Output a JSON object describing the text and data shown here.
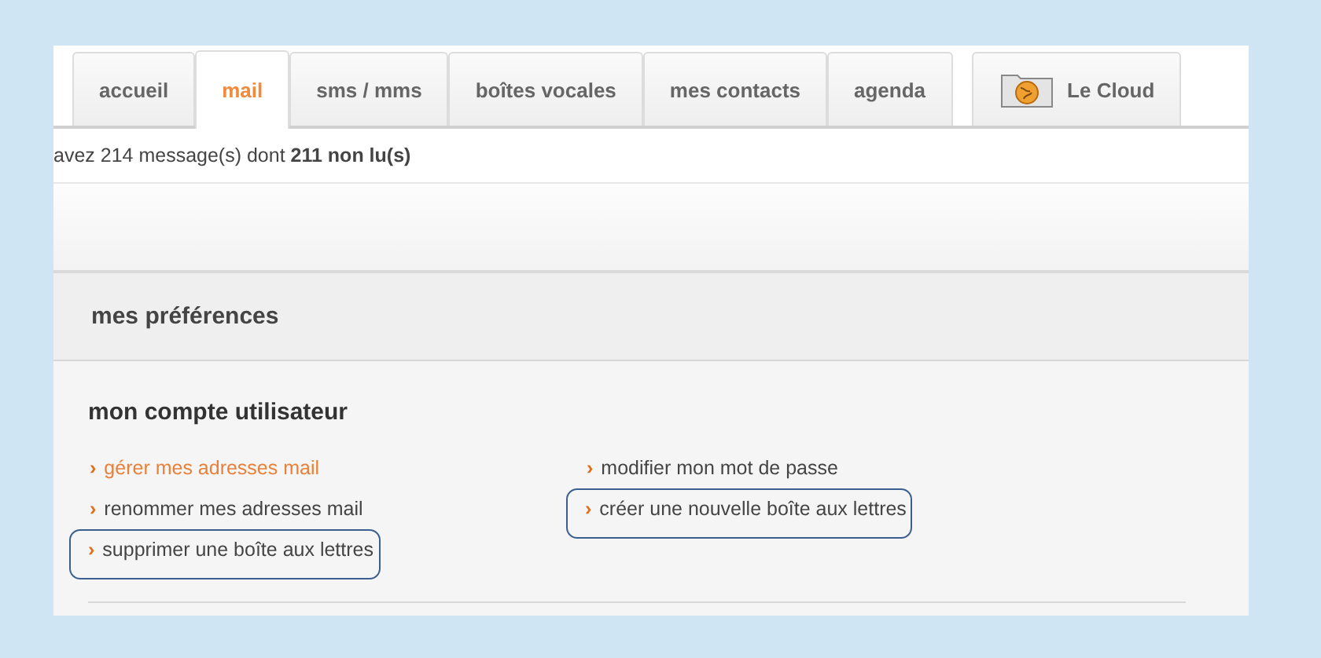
{
  "tabs": [
    {
      "label": "accueil",
      "selected": false
    },
    {
      "label": "mail",
      "selected": true
    },
    {
      "label": "sms / mms",
      "selected": false
    },
    {
      "label": "boîtes vocales",
      "selected": false
    },
    {
      "label": "mes contacts",
      "selected": false
    },
    {
      "label": "agenda",
      "selected": false
    },
    {
      "label": "Le Cloud",
      "selected": false,
      "kind": "cloud"
    }
  ],
  "message": "avez 214 message(s) dont **211 non lu(s)**",
  "section": {
    "title": "mes préférences"
  },
  "group": {
    "title": "mon compte utilisateur",
    "columns": [
      [
        {
          "chevron": "›",
          "label": "gérer mes adresses mail",
          "active": true,
          "highlighted": false
        },
        {
          "chevron": "›",
          "label": "renommer mes adresses mail",
          "active": false,
          "highlighted": false
        },
        {
          "chevron": "›",
          "label": "supprimer une boîte aux lettres",
          "active": false,
          "highlighted": true
        }
      ],
      [
        {
          "chevron": "›",
          "label": "modifier mon mot de passe",
          "active": false,
          "highlighted": false
        },
        {
          "chevron": "›",
          "label": "créer une nouvelle boîte aux lettres",
          "active": false,
          "highlighted": true
        }
      ]
    ]
  }
}
